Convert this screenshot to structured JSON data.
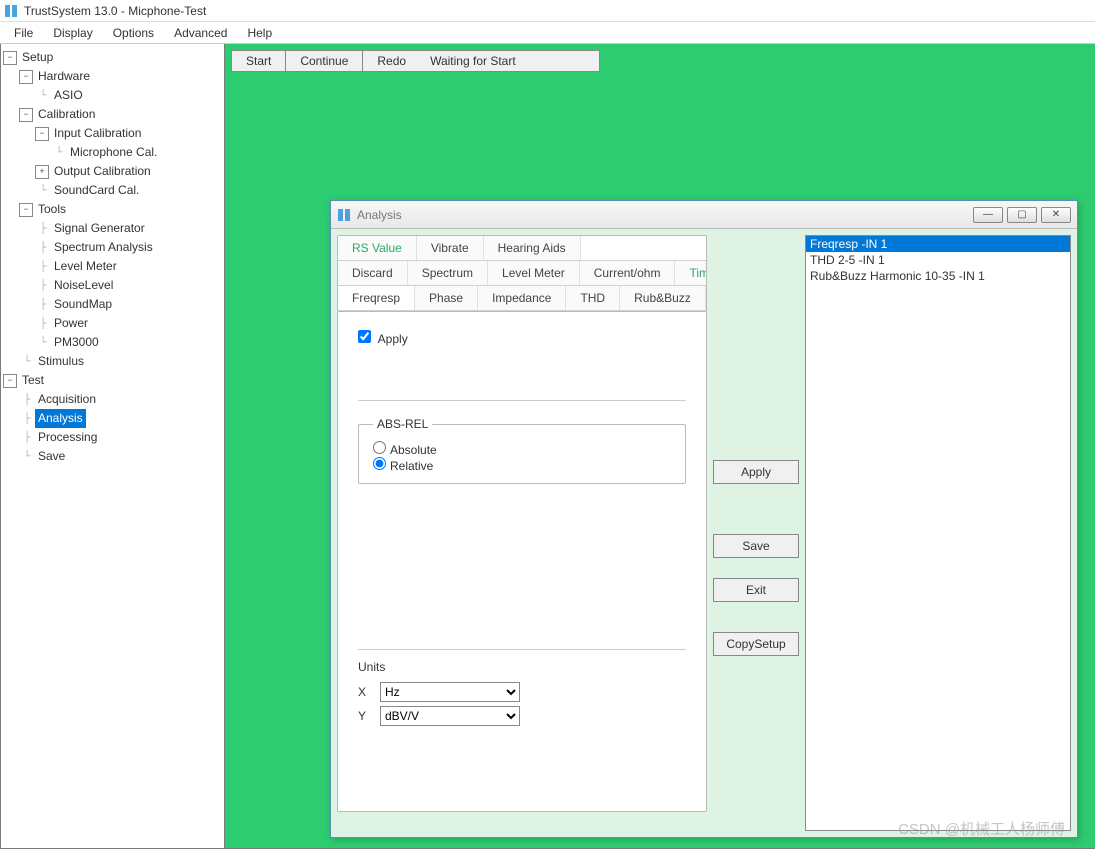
{
  "window": {
    "title": "TrustSystem 13.0 - Micphone-Test"
  },
  "menu": {
    "file": "File",
    "display": "Display",
    "options": "Options",
    "advanced": "Advanced",
    "help": "Help"
  },
  "tree": {
    "setup": "Setup",
    "hardware": "Hardware",
    "asio": "ASIO",
    "calibration": "Calibration",
    "input_cal": "Input Calibration",
    "mic_cal": "Microphone Cal.",
    "output_cal": "Output Calibration",
    "soundcard_cal": "SoundCard Cal.",
    "tools": "Tools",
    "signal_gen": "Signal Generator",
    "spectrum": "Spectrum Analysis",
    "level": "Level Meter",
    "noise": "NoiseLevel",
    "soundmap": "SoundMap",
    "power": "Power",
    "pm3000": "PM3000",
    "stimulus": "Stimulus",
    "test": "Test",
    "acq": "Acquisition",
    "analysis": "Analysis",
    "processing": "Processing",
    "save": "Save"
  },
  "toolbar": {
    "start": "Start",
    "continue": "Continue",
    "redo": "Redo",
    "status": "Waiting for Start"
  },
  "dialog": {
    "title": "Analysis",
    "tabs_r1": {
      "rs": "RS Value",
      "vibrate": "Vibrate",
      "hearing": "Hearing Aids"
    },
    "tabs_r2": {
      "discard": "Discard",
      "spectrum": "Spectrum",
      "level": "Level Meter",
      "current": "Current/ohm",
      "times": "Times"
    },
    "tabs_r3": {
      "freq": "Freqresp",
      "phase": "Phase",
      "imp": "Impedance",
      "thd": "THD",
      "rub": "Rub&Buzz"
    },
    "apply_check": "Apply",
    "absrel": {
      "legend": "ABS-REL",
      "abs": "Absolute",
      "rel": "Relative"
    },
    "units": {
      "legend": "Units",
      "x": "X",
      "y": "Y",
      "xval": "Hz",
      "yval": "dBV/V"
    },
    "buttons": {
      "apply": "Apply",
      "save": "Save",
      "exit": "Exit",
      "copy": "CopySetup"
    },
    "list": {
      "i0": "Freqresp -IN 1",
      "i1": "THD 2-5 -IN 1",
      "i2": "Rub&Buzz Harmonic 10-35 -IN 1"
    }
  },
  "watermark": "CSDN @机械工人杨师傅"
}
